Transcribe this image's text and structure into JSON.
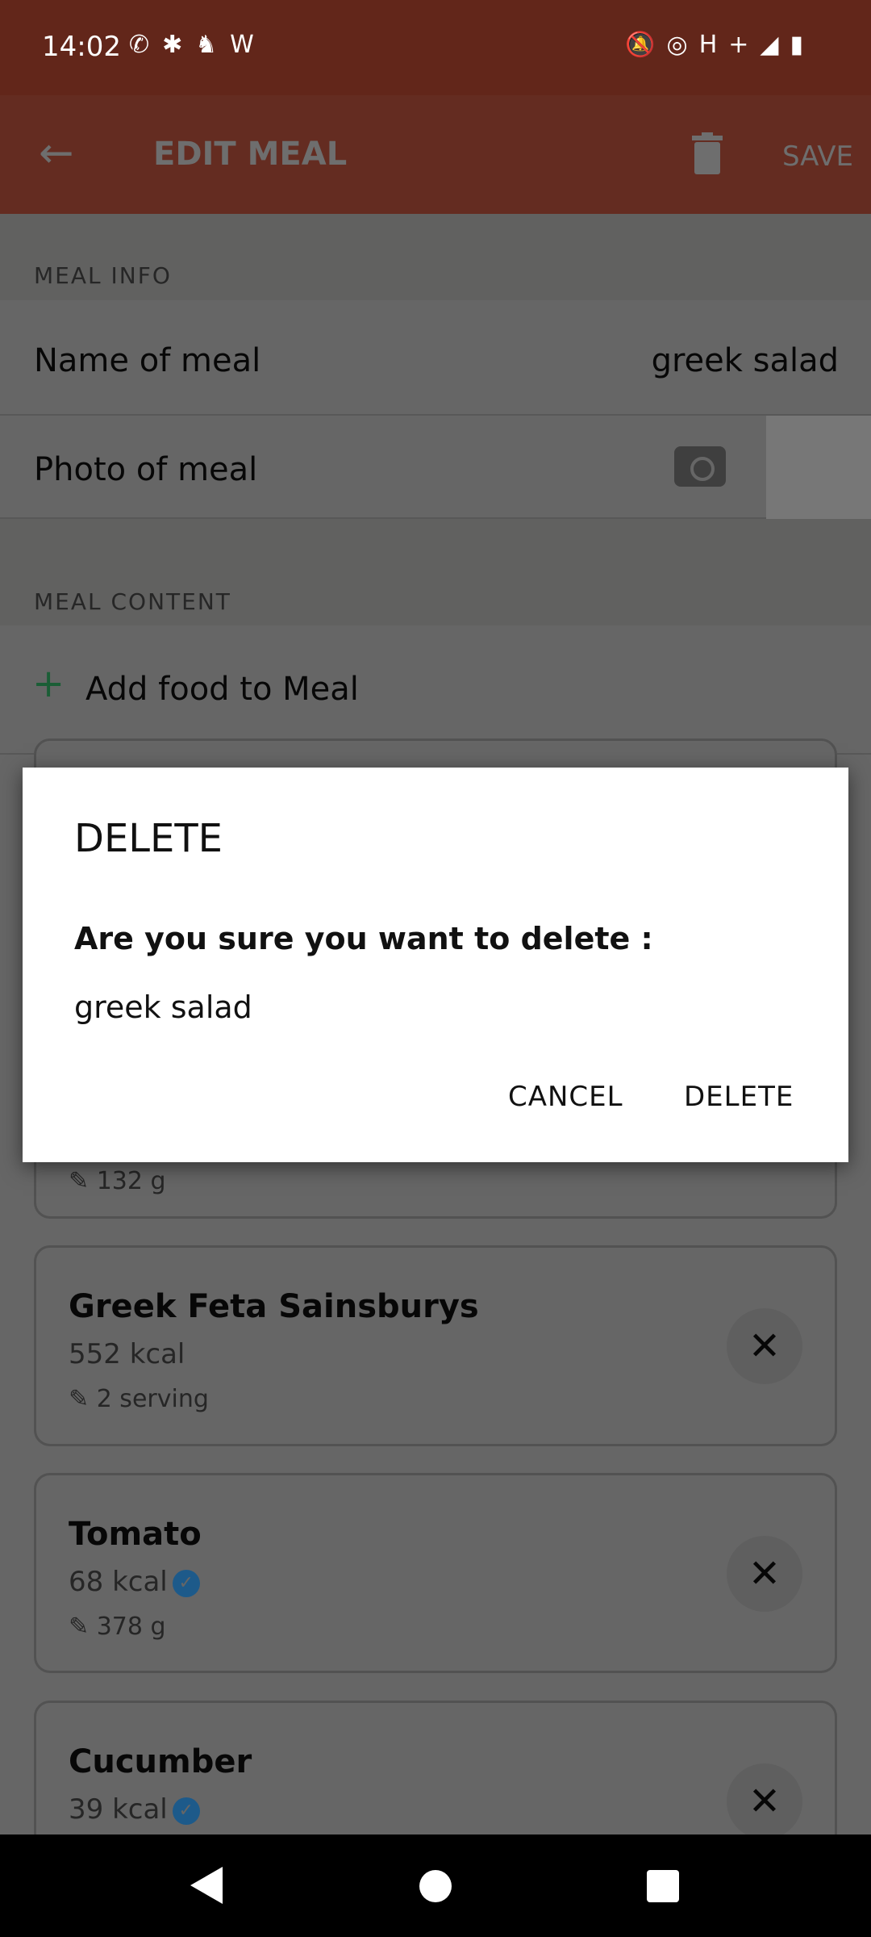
{
  "status_bar": {
    "time": "14:02",
    "left_icons": [
      "whatsapp-icon",
      "slack-icon",
      "app-icon",
      "w-icon"
    ],
    "network": "H+",
    "right_icons": [
      "bell-off-icon",
      "hotspot-icon",
      "signal-icon",
      "battery-charging-icon"
    ]
  },
  "app_bar": {
    "title": "EDIT MEAL",
    "save_label": "SAVE",
    "accent": "#fa6f52"
  },
  "meal_info": {
    "header": "MEAL INFO",
    "name_label": "Name of meal",
    "name_value": "greek salad",
    "photo_label": "Photo of meal"
  },
  "meal_content": {
    "header": "MEAL CONTENT",
    "add_label": "Add food to Meal"
  },
  "foods": [
    {
      "quantity": "132 g"
    },
    {
      "name": "Greek Feta Sainsburys",
      "kcal": "552 kcal",
      "quantity": "2 serving",
      "verified": false
    },
    {
      "name": "Tomato",
      "kcal": "68 kcal",
      "quantity": "378 g",
      "verified": true
    },
    {
      "name": "Cucumber",
      "kcal": "39 kcal",
      "verified": true
    }
  ],
  "dialog": {
    "title": "DELETE",
    "question": "Are you sure you want to delete :",
    "item": "greek salad",
    "cancel_label": "CANCEL",
    "delete_label": "DELETE"
  }
}
